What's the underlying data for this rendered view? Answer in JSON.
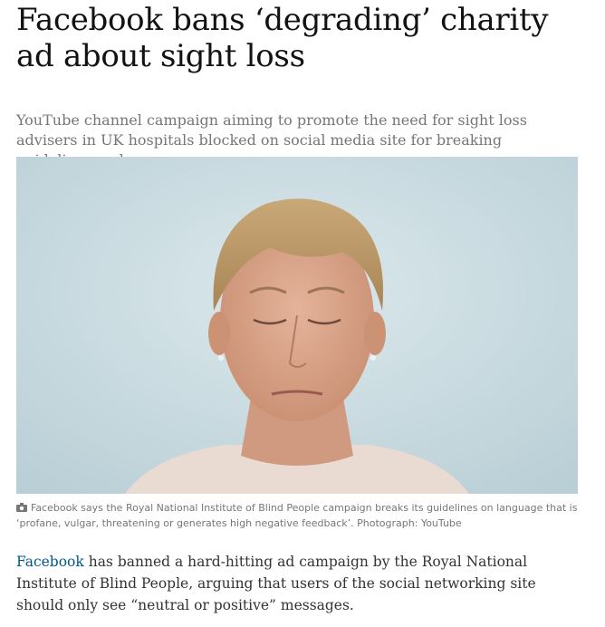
{
  "article": {
    "headline": "Facebook bans ‘degrading’ charity ad about sight loss",
    "standfirst": "YouTube channel campaign aiming to promote the need for sight loss advisers in UK hospitals blocked on social media site for breaking guidelines on language",
    "image": {
      "caption": "Facebook says the Royal National Institute of Blind People campaign breaks its guidelines on language that is ‘profane, vulgar, threatening or generates high negative feedback’. Photograph: YouTube"
    },
    "body": {
      "link_text": "Facebook",
      "text": " has banned a hard-hitting ad campaign by the Royal National Institute of Blind People, arguing that users of the social networking site should only see “neutral or positive” messages."
    }
  },
  "colors": {
    "headline": "#121212",
    "standfirst": "#767676",
    "link": "#005689",
    "photo_background": "#cfe0e5"
  },
  "icons": [
    "camera-icon"
  ]
}
